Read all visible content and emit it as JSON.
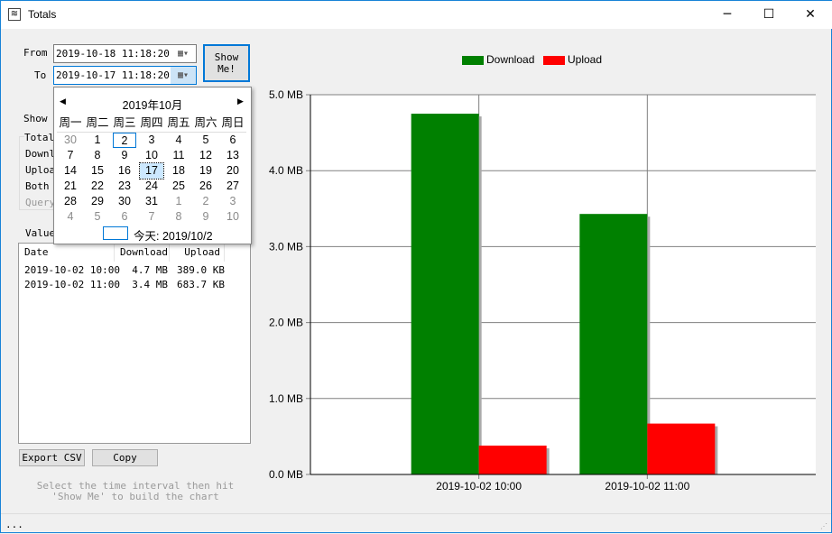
{
  "window": {
    "title": "Totals",
    "icon": "chart-app-icon",
    "minimize": "─",
    "maximize": "☐",
    "close": "✕"
  },
  "form": {
    "from_label": "From",
    "from_value": "2019-10-18 11:18:20",
    "to_label": "To",
    "to_value": "2019-10-17 11:18:20",
    "show_button": "Show Me!",
    "calendar_icon": "calendar-icon"
  },
  "options": {
    "show_label": "Show",
    "group_title": "Total",
    "items": [
      "Downl",
      "Uploa",
      "Both",
      "Query"
    ]
  },
  "calendar": {
    "month_title": "2019年10月",
    "weekdays": [
      "周一",
      "周二",
      "周三",
      "周四",
      "周五",
      "周六",
      "周日"
    ],
    "days": [
      [
        "30",
        1
      ],
      [
        "1",
        0
      ],
      [
        "2",
        0
      ],
      [
        "3",
        0
      ],
      [
        "4",
        0
      ],
      [
        "5",
        0
      ],
      [
        "6",
        0
      ],
      [
        "7",
        0
      ],
      [
        "8",
        0
      ],
      [
        "9",
        0
      ],
      [
        "10",
        0
      ],
      [
        "11",
        0
      ],
      [
        "12",
        0
      ],
      [
        "13",
        0
      ],
      [
        "14",
        0
      ],
      [
        "15",
        0
      ],
      [
        "16",
        0
      ],
      [
        "17",
        0
      ],
      [
        "18",
        0
      ],
      [
        "19",
        0
      ],
      [
        "20",
        0
      ],
      [
        "21",
        0
      ],
      [
        "22",
        0
      ],
      [
        "23",
        0
      ],
      [
        "24",
        0
      ],
      [
        "25",
        0
      ],
      [
        "26",
        0
      ],
      [
        "27",
        0
      ],
      [
        "28",
        0
      ],
      [
        "29",
        0
      ],
      [
        "30",
        0
      ],
      [
        "31",
        0
      ],
      [
        "1",
        1
      ],
      [
        "2",
        1
      ],
      [
        "3",
        1
      ],
      [
        "4",
        1
      ],
      [
        "5",
        1
      ],
      [
        "6",
        1
      ],
      [
        "7",
        1
      ],
      [
        "8",
        1
      ],
      [
        "9",
        1
      ],
      [
        "10",
        1
      ]
    ],
    "today_day": "2",
    "selected_day": "17",
    "today_label": "今天: 2019/10/2"
  },
  "values": {
    "label": "Value",
    "columns": [
      "Date",
      "Download",
      "Upload"
    ],
    "rows": [
      [
        "2019-10-02 10:00",
        "4.7 MB",
        "389.0 KB"
      ],
      [
        "2019-10-02 11:00",
        "3.4 MB",
        "683.7 KB"
      ]
    ]
  },
  "buttons": {
    "export": "Export CSV",
    "copy": "Copy"
  },
  "hint": "Select the time interval then hit 'Show Me' to build the chart",
  "status": "...",
  "chart_data": {
    "type": "bar",
    "categories": [
      "2019-10-02 10:00",
      "2019-10-02 11:00"
    ],
    "series": [
      {
        "name": "Download",
        "color": "#008000",
        "values": [
          4.75,
          3.43
        ]
      },
      {
        "name": "Upload",
        "color": "#ff0000",
        "values": [
          0.38,
          0.67
        ]
      }
    ],
    "yticks": [
      "0.0 MB",
      "1.0 MB",
      "2.0 MB",
      "3.0 MB",
      "4.0 MB",
      "5.0 MB"
    ],
    "ylim": [
      0,
      5
    ],
    "grid": true,
    "legend": "top"
  }
}
